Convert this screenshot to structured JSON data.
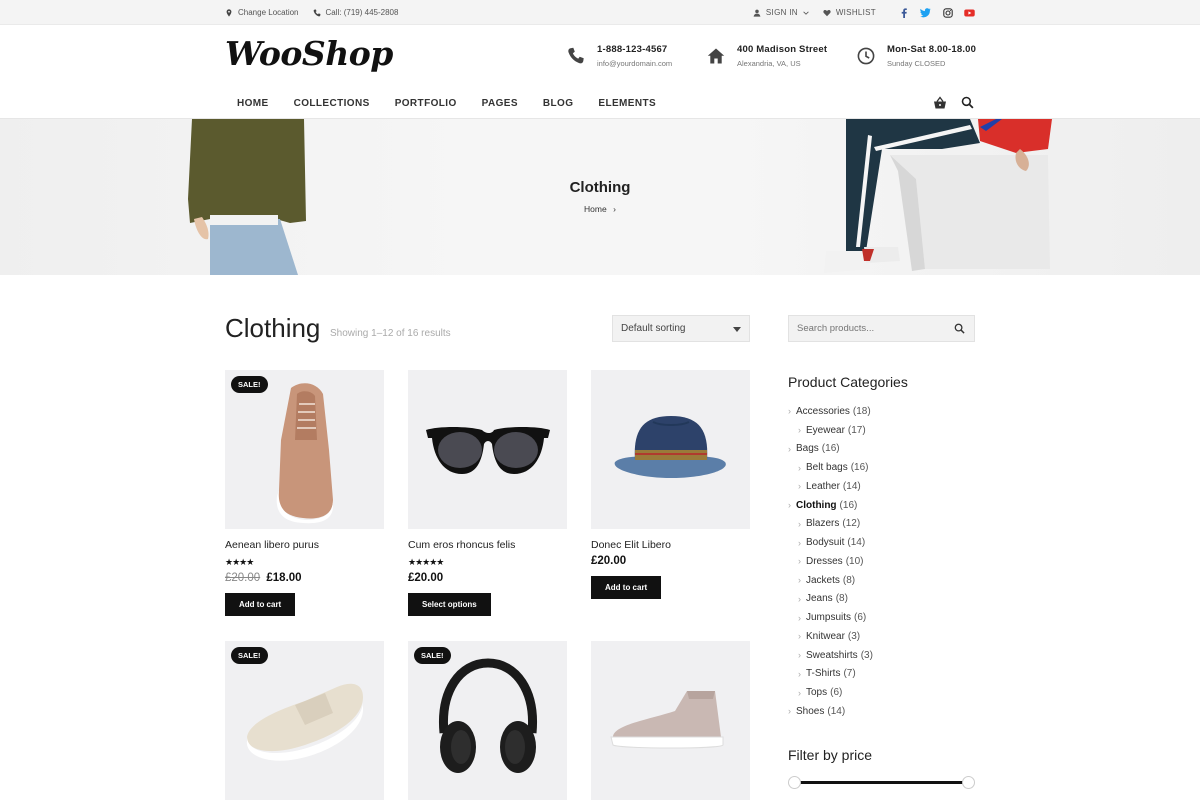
{
  "topbar": {
    "location": "Change Location",
    "call": "Call: (719) 445-2808",
    "sign_in": "SIGN IN",
    "wishlist": "WISHLIST",
    "social": [
      "facebook-icon",
      "twitter-icon",
      "instagram-icon",
      "youtube-icon"
    ]
  },
  "header": {
    "logo": "WooShop",
    "phone": {
      "line1": "1-888-123-4567",
      "line2": "info@yourdomain.com"
    },
    "address": {
      "line1": "400 Madison Street",
      "line2": "Alexandria, VA, US"
    },
    "hours": {
      "line1": "Mon-Sat 8.00-18.00",
      "line2": "Sunday CLOSED"
    }
  },
  "nav": {
    "items": [
      "HOME",
      "COLLECTIONS",
      "PORTFOLIO",
      "PAGES",
      "BLOG",
      "ELEMENTS"
    ]
  },
  "hero": {
    "title": "Clothing",
    "breadcrumb": "Home"
  },
  "main": {
    "title": "Clothing",
    "result_count": "Showing 1–12 of 16 results",
    "sorting": "Default sorting"
  },
  "products": [
    {
      "name": "Aenean libero purus",
      "sale": "SALE!",
      "rating": 4,
      "old_price": "£20.00",
      "price": "£18.00",
      "button": "Add to cart"
    },
    {
      "name": "Cum eros rhoncus felis",
      "sale": "",
      "rating": 5,
      "old_price": "",
      "price": "£20.00",
      "button": "Select options"
    },
    {
      "name": "Donec Elit Libero",
      "sale": "",
      "rating": 0,
      "old_price": "",
      "price": "£20.00",
      "button": "Add to cart"
    },
    {
      "name": "",
      "sale": "SALE!",
      "rating": 0,
      "old_price": "",
      "price": "",
      "button": ""
    },
    {
      "name": "",
      "sale": "SALE!",
      "rating": 0,
      "old_price": "",
      "price": "",
      "button": ""
    },
    {
      "name": "",
      "sale": "",
      "rating": 0,
      "old_price": "",
      "price": "",
      "button": ""
    }
  ],
  "sidebar": {
    "search_placeholder": "Search products...",
    "categories_title": "Product Categories",
    "categories": [
      {
        "name": "Accessories",
        "count": "(18)",
        "level": 0
      },
      {
        "name": "Eyewear",
        "count": "(17)",
        "level": 1
      },
      {
        "name": "Bags",
        "count": "(16)",
        "level": 0
      },
      {
        "name": "Belt bags",
        "count": "(16)",
        "level": 1
      },
      {
        "name": "Leather",
        "count": "(14)",
        "level": 1
      },
      {
        "name": "Clothing",
        "count": "(16)",
        "level": 0,
        "active": true
      },
      {
        "name": "Blazers",
        "count": "(12)",
        "level": 1
      },
      {
        "name": "Bodysuit",
        "count": "(14)",
        "level": 1
      },
      {
        "name": "Dresses",
        "count": "(10)",
        "level": 1
      },
      {
        "name": "Jackets",
        "count": "(8)",
        "level": 1
      },
      {
        "name": "Jeans",
        "count": "(8)",
        "level": 1
      },
      {
        "name": "Jumpsuits",
        "count": "(6)",
        "level": 1
      },
      {
        "name": "Knitwear",
        "count": "(3)",
        "level": 1
      },
      {
        "name": "Sweatshirts",
        "count": "(3)",
        "level": 1
      },
      {
        "name": "T-Shirts",
        "count": "(7)",
        "level": 1
      },
      {
        "name": "Tops",
        "count": "(6)",
        "level": 1
      },
      {
        "name": "Shoes",
        "count": "(14)",
        "level": 0
      }
    ],
    "price_filter_title": "Filter by price",
    "price_range": {
      "min_fraction": 0.0,
      "max_fraction": 1.0
    }
  },
  "colors": {
    "accent": "#111111",
    "background": "#ffffff",
    "muted": "#f0f0f2",
    "youtube": "#e52d27",
    "twitter": "#1da1f2",
    "facebook": "#3b5998"
  }
}
